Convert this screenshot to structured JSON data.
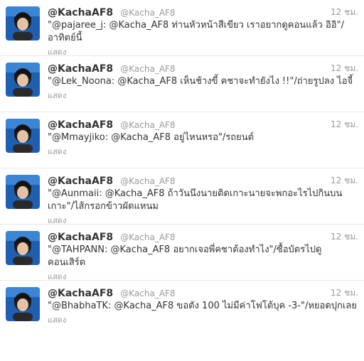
{
  "tweets": [
    {
      "fullname": "@KachaAF8",
      "username": "@Kacha_AF8",
      "time": "12 ชม.",
      "text": "\"@pajaree_j: @Kacha_AF8 ท่านหัวหน้าสีเขียว เราอยากดูคอนแล้ว อิอิ\"/อาทิตย์นี้",
      "expand": "แสดง"
    },
    {
      "fullname": "@KachaAF8",
      "username": "@Kacha_AF8",
      "time": "12 ชม.",
      "text": "\"@Lek_Noona: @Kacha_AF8 เห็นช้างขี้ คชาจะทำยังไง !!\"/ถ่ายรูปลง ไอจี้",
      "expand": "แสดง"
    },
    {
      "fullname": "@KachaAF8",
      "username": "@Kacha_AF8",
      "time": "12 ชม.",
      "text": "\"@Mmayjiko: @Kacha_AF8 อยู่ไหนหรอ\"/รถยนต์",
      "expand": "แสดง"
    },
    {
      "fullname": "@KachaAF8",
      "username": "@Kacha_AF8",
      "time": "12 ชม.",
      "text": "\"@Aunmaii: @Kacha_AF8 ถ้าวันนึงนายติดเกาะนายจะพกอะไรไปกินบนเกาะ\"/ไส้กรอกข้าวผัดแหนม",
      "expand": "แสดง"
    },
    {
      "fullname": "@KachaAF8",
      "username": "@Kacha_AF8",
      "time": "12 ชม.",
      "text": "\"@TAHPANN: @Kacha_AF8 อยากเจอพี่คชาต้องทำไง\"/ซื้อบัตรไปดูคอนเสิร์ต",
      "expand": "แสดง"
    },
    {
      "fullname": "@KachaAF8",
      "username": "@Kacha_AF8",
      "time": "12 ชม.",
      "text": "\"@BhabhaTK: @Kacha_AF8 ขอตัง 100 ไม่มีค่าโฟโต้บุค -3-\"/หยอดปุกเลย",
      "expand": "แสดง"
    }
  ]
}
